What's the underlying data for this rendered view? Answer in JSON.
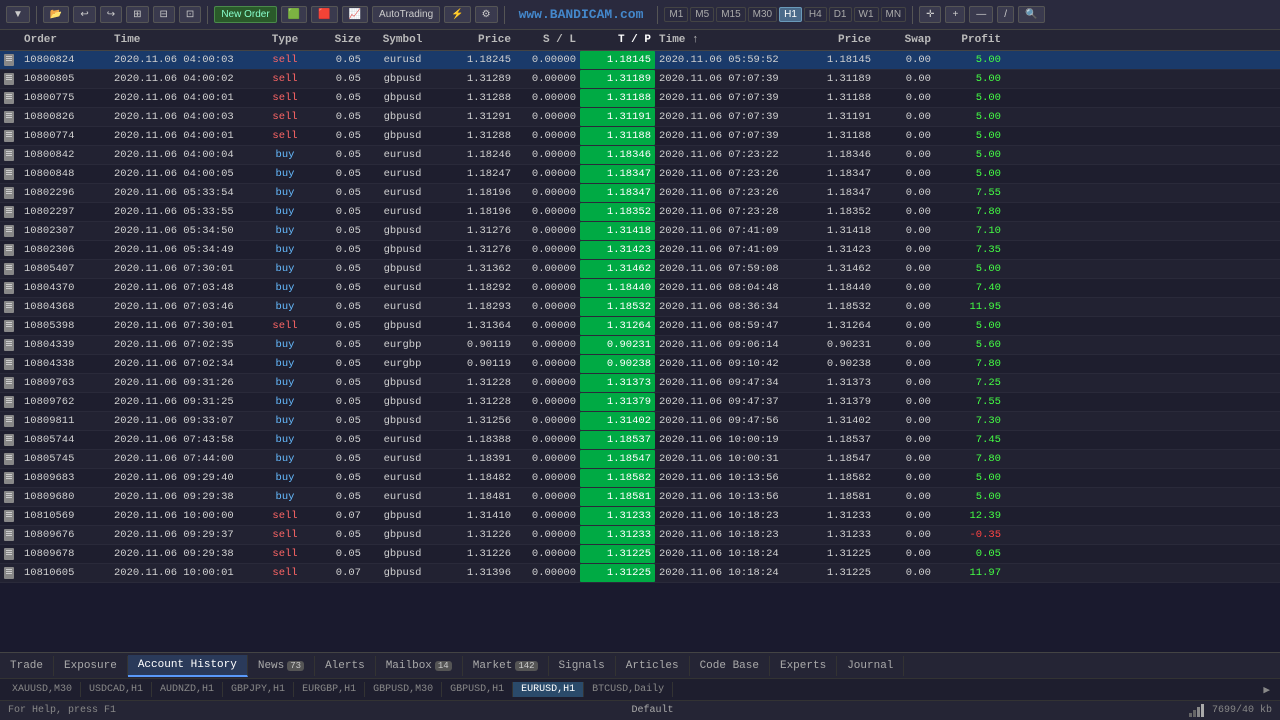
{
  "toolbar": {
    "buttons": [
      "▼",
      "📁",
      "↩",
      "↪",
      "⊞",
      "⊟"
    ],
    "new_order": "New Order",
    "auto_trading": "AutoTrading",
    "timeframes": [
      "M1",
      "M5",
      "M15",
      "M30",
      "H1",
      "H4",
      "D1",
      "W1",
      "MN"
    ],
    "active_tf": "H1",
    "tools": [
      "+",
      "✕",
      "—",
      "/",
      "🔍"
    ],
    "watermark": "www.BANDICAM.com"
  },
  "table": {
    "headers": [
      "",
      "Order",
      "Time",
      "Type",
      "Size",
      "Symbol",
      "Price",
      "S / L",
      "T / P",
      "Time",
      "Price",
      "Swap",
      "Profit"
    ],
    "rows": [
      {
        "order": "10800824",
        "open_time": "2020.11.06 04:00:03",
        "type": "sell",
        "size": "0.05",
        "symbol": "eurusd",
        "price": "1.18245",
        "sl": "0.00000",
        "tp": "1.18145",
        "close_time": "2020.11.06 05:59:52",
        "close_price": "1.18145",
        "swap": "0.00",
        "profit": "5.00",
        "selected": true
      },
      {
        "order": "10800805",
        "open_time": "2020.11.06 04:00:02",
        "type": "sell",
        "size": "0.05",
        "symbol": "gbpusd",
        "price": "1.31289",
        "sl": "0.00000",
        "tp": "1.31189",
        "close_time": "2020.11.06 07:07:39",
        "close_price": "1.31189",
        "swap": "0.00",
        "profit": "5.00",
        "selected": false
      },
      {
        "order": "10800775",
        "open_time": "2020.11.06 04:00:01",
        "type": "sell",
        "size": "0.05",
        "symbol": "gbpusd",
        "price": "1.31288",
        "sl": "0.00000",
        "tp": "1.31188",
        "close_time": "2020.11.06 07:07:39",
        "close_price": "1.31188",
        "swap": "0.00",
        "profit": "5.00",
        "selected": false
      },
      {
        "order": "10800826",
        "open_time": "2020.11.06 04:00:03",
        "type": "sell",
        "size": "0.05",
        "symbol": "gbpusd",
        "price": "1.31291",
        "sl": "0.00000",
        "tp": "1.31191",
        "close_time": "2020.11.06 07:07:39",
        "close_price": "1.31191",
        "swap": "0.00",
        "profit": "5.00",
        "selected": false
      },
      {
        "order": "10800774",
        "open_time": "2020.11.06 04:00:01",
        "type": "sell",
        "size": "0.05",
        "symbol": "gbpusd",
        "price": "1.31288",
        "sl": "0.00000",
        "tp": "1.31188",
        "close_time": "2020.11.06 07:07:39",
        "close_price": "1.31188",
        "swap": "0.00",
        "profit": "5.00",
        "selected": false
      },
      {
        "order": "10800842",
        "open_time": "2020.11.06 04:00:04",
        "type": "buy",
        "size": "0.05",
        "symbol": "eurusd",
        "price": "1.18246",
        "sl": "0.00000",
        "tp": "1.18346",
        "close_time": "2020.11.06 07:23:22",
        "close_price": "1.18346",
        "swap": "0.00",
        "profit": "5.00",
        "selected": false
      },
      {
        "order": "10800848",
        "open_time": "2020.11.06 04:00:05",
        "type": "buy",
        "size": "0.05",
        "symbol": "eurusd",
        "price": "1.18247",
        "sl": "0.00000",
        "tp": "1.18347",
        "close_time": "2020.11.06 07:23:26",
        "close_price": "1.18347",
        "swap": "0.00",
        "profit": "5.00",
        "selected": false
      },
      {
        "order": "10802296",
        "open_time": "2020.11.06 05:33:54",
        "type": "buy",
        "size": "0.05",
        "symbol": "eurusd",
        "price": "1.18196",
        "sl": "0.00000",
        "tp": "1.18347",
        "close_time": "2020.11.06 07:23:26",
        "close_price": "1.18347",
        "swap": "0.00",
        "profit": "7.55",
        "selected": false
      },
      {
        "order": "10802297",
        "open_time": "2020.11.06 05:33:55",
        "type": "buy",
        "size": "0.05",
        "symbol": "eurusd",
        "price": "1.18196",
        "sl": "0.00000",
        "tp": "1.18352",
        "close_time": "2020.11.06 07:23:28",
        "close_price": "1.18352",
        "swap": "0.00",
        "profit": "7.80",
        "selected": false
      },
      {
        "order": "10802307",
        "open_time": "2020.11.06 05:34:50",
        "type": "buy",
        "size": "0.05",
        "symbol": "gbpusd",
        "price": "1.31276",
        "sl": "0.00000",
        "tp": "1.31418",
        "close_time": "2020.11.06 07:41:09",
        "close_price": "1.31418",
        "swap": "0.00",
        "profit": "7.10",
        "selected": false
      },
      {
        "order": "10802306",
        "open_time": "2020.11.06 05:34:49",
        "type": "buy",
        "size": "0.05",
        "symbol": "gbpusd",
        "price": "1.31276",
        "sl": "0.00000",
        "tp": "1.31423",
        "close_time": "2020.11.06 07:41:09",
        "close_price": "1.31423",
        "swap": "0.00",
        "profit": "7.35",
        "selected": false
      },
      {
        "order": "10805407",
        "open_time": "2020.11.06 07:30:01",
        "type": "buy",
        "size": "0.05",
        "symbol": "gbpusd",
        "price": "1.31362",
        "sl": "0.00000",
        "tp": "1.31462",
        "close_time": "2020.11.06 07:59:08",
        "close_price": "1.31462",
        "swap": "0.00",
        "profit": "5.00",
        "selected": false
      },
      {
        "order": "10804370",
        "open_time": "2020.11.06 07:03:48",
        "type": "buy",
        "size": "0.05",
        "symbol": "eurusd",
        "price": "1.18292",
        "sl": "0.00000",
        "tp": "1.18440",
        "close_time": "2020.11.06 08:04:48",
        "close_price": "1.18440",
        "swap": "0.00",
        "profit": "7.40",
        "selected": false
      },
      {
        "order": "10804368",
        "open_time": "2020.11.06 07:03:46",
        "type": "buy",
        "size": "0.05",
        "symbol": "eurusd",
        "price": "1.18293",
        "sl": "0.00000",
        "tp": "1.18532",
        "close_time": "2020.11.06 08:36:34",
        "close_price": "1.18532",
        "swap": "0.00",
        "profit": "11.95",
        "selected": false
      },
      {
        "order": "10805398",
        "open_time": "2020.11.06 07:30:01",
        "type": "sell",
        "size": "0.05",
        "symbol": "gbpusd",
        "price": "1.31364",
        "sl": "0.00000",
        "tp": "1.31264",
        "close_time": "2020.11.06 08:59:47",
        "close_price": "1.31264",
        "swap": "0.00",
        "profit": "5.00",
        "selected": false
      },
      {
        "order": "10804339",
        "open_time": "2020.11.06 07:02:35",
        "type": "buy",
        "size": "0.05",
        "symbol": "eurgbp",
        "price": "0.90119",
        "sl": "0.00000",
        "tp": "0.90231",
        "close_time": "2020.11.06 09:06:14",
        "close_price": "0.90231",
        "swap": "0.00",
        "profit": "5.60",
        "selected": false
      },
      {
        "order": "10804338",
        "open_time": "2020.11.06 07:02:34",
        "type": "buy",
        "size": "0.05",
        "symbol": "eurgbp",
        "price": "0.90119",
        "sl": "0.00000",
        "tp": "0.90238",
        "close_time": "2020.11.06 09:10:42",
        "close_price": "0.90238",
        "swap": "0.00",
        "profit": "7.80",
        "selected": false
      },
      {
        "order": "10809763",
        "open_time": "2020.11.06 09:31:26",
        "type": "buy",
        "size": "0.05",
        "symbol": "gbpusd",
        "price": "1.31228",
        "sl": "0.00000",
        "tp": "1.31373",
        "close_time": "2020.11.06 09:47:34",
        "close_price": "1.31373",
        "swap": "0.00",
        "profit": "7.25",
        "selected": false
      },
      {
        "order": "10809762",
        "open_time": "2020.11.06 09:31:25",
        "type": "buy",
        "size": "0.05",
        "symbol": "gbpusd",
        "price": "1.31228",
        "sl": "0.00000",
        "tp": "1.31379",
        "close_time": "2020.11.06 09:47:37",
        "close_price": "1.31379",
        "swap": "0.00",
        "profit": "7.55",
        "selected": false
      },
      {
        "order": "10809811",
        "open_time": "2020.11.06 09:33:07",
        "type": "buy",
        "size": "0.05",
        "symbol": "gbpusd",
        "price": "1.31256",
        "sl": "0.00000",
        "tp": "1.31402",
        "close_time": "2020.11.06 09:47:56",
        "close_price": "1.31402",
        "swap": "0.00",
        "profit": "7.30",
        "selected": false
      },
      {
        "order": "10805744",
        "open_time": "2020.11.06 07:43:58",
        "type": "buy",
        "size": "0.05",
        "symbol": "eurusd",
        "price": "1.18388",
        "sl": "0.00000",
        "tp": "1.18537",
        "close_time": "2020.11.06 10:00:19",
        "close_price": "1.18537",
        "swap": "0.00",
        "profit": "7.45",
        "selected": false
      },
      {
        "order": "10805745",
        "open_time": "2020.11.06 07:44:00",
        "type": "buy",
        "size": "0.05",
        "symbol": "eurusd",
        "price": "1.18391",
        "sl": "0.00000",
        "tp": "1.18547",
        "close_time": "2020.11.06 10:00:31",
        "close_price": "1.18547",
        "swap": "0.00",
        "profit": "7.80",
        "selected": false
      },
      {
        "order": "10809683",
        "open_time": "2020.11.06 09:29:40",
        "type": "buy",
        "size": "0.05",
        "symbol": "eurusd",
        "price": "1.18482",
        "sl": "0.00000",
        "tp": "1.18582",
        "close_time": "2020.11.06 10:13:56",
        "close_price": "1.18582",
        "swap": "0.00",
        "profit": "5.00",
        "selected": false
      },
      {
        "order": "10809680",
        "open_time": "2020.11.06 09:29:38",
        "type": "buy",
        "size": "0.05",
        "symbol": "eurusd",
        "price": "1.18481",
        "sl": "0.00000",
        "tp": "1.18581",
        "close_time": "2020.11.06 10:13:56",
        "close_price": "1.18581",
        "swap": "0.00",
        "profit": "5.00",
        "selected": false
      },
      {
        "order": "10810569",
        "open_time": "2020.11.06 10:00:00",
        "type": "sell",
        "size": "0.07",
        "symbol": "gbpusd",
        "price": "1.31410",
        "sl": "0.00000",
        "tp": "1.31233",
        "close_time": "2020.11.06 10:18:23",
        "close_price": "1.31233",
        "swap": "0.00",
        "profit": "12.39",
        "selected": false
      },
      {
        "order": "10809676",
        "open_time": "2020.11.06 09:29:37",
        "type": "sell",
        "size": "0.05",
        "symbol": "gbpusd",
        "price": "1.31226",
        "sl": "0.00000",
        "tp": "1.31233",
        "close_time": "2020.11.06 10:18:23",
        "close_price": "1.31233",
        "swap": "0.00",
        "profit": "-0.35",
        "selected": false
      },
      {
        "order": "10809678",
        "open_time": "2020.11.06 09:29:38",
        "type": "sell",
        "size": "0.05",
        "symbol": "gbpusd",
        "price": "1.31226",
        "sl": "0.00000",
        "tp": "1.31225",
        "close_time": "2020.11.06 10:18:24",
        "close_price": "1.31225",
        "swap": "0.00",
        "profit": "0.05",
        "selected": false
      },
      {
        "order": "10810605",
        "open_time": "2020.11.06 10:00:01",
        "type": "sell",
        "size": "0.07",
        "symbol": "gbpusd",
        "price": "1.31396",
        "sl": "0.00000",
        "tp": "1.31225",
        "close_time": "2020.11.06 10:18:24",
        "close_price": "1.31225",
        "swap": "0.00",
        "profit": "11.97",
        "selected": false
      }
    ]
  },
  "bottom_tabs": [
    {
      "label": "Trade",
      "badge": null,
      "active": false
    },
    {
      "label": "Exposure",
      "badge": null,
      "active": false
    },
    {
      "label": "Account History",
      "badge": null,
      "active": true
    },
    {
      "label": "News",
      "badge": "73",
      "active": false
    },
    {
      "label": "Alerts",
      "badge": null,
      "active": false
    },
    {
      "label": "Mailbox",
      "badge": "14",
      "active": false
    },
    {
      "label": "Market",
      "badge": "142",
      "active": false
    },
    {
      "label": "Signals",
      "badge": null,
      "active": false
    },
    {
      "label": "Articles",
      "badge": null,
      "active": false
    },
    {
      "label": "Code Base",
      "badge": null,
      "active": false
    },
    {
      "label": "Experts",
      "badge": null,
      "active": false
    },
    {
      "label": "Journal",
      "badge": null,
      "active": false
    }
  ],
  "symbol_bar": {
    "symbols": [
      "XAUUSD,M30",
      "USDCAD,H1",
      "AUDNZD,H1",
      "GBPJPY,H1",
      "EURGBP,H1",
      "GBPUSD,M30",
      "GBPUSD,H1",
      "EURUSD,H1",
      "BTCUSD,Daily"
    ],
    "active_symbol": "EURUSD,H1"
  },
  "status_bar": {
    "left": "For Help, press F1",
    "center": "Default",
    "right": "7699/40 kb"
  }
}
